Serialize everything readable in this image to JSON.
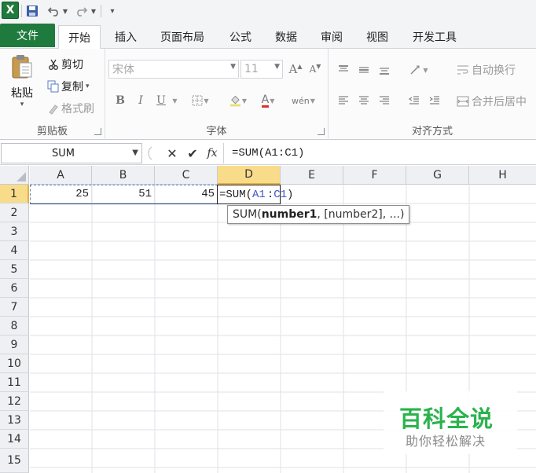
{
  "qat": {
    "logo": "X",
    "more": "▾"
  },
  "tabs": [
    "文件",
    "开始",
    "插入",
    "页面布局",
    "公式",
    "数据",
    "审阅",
    "视图",
    "开发工具"
  ],
  "clipboard": {
    "paste": "粘贴",
    "cut": "剪切",
    "copy": "复制",
    "painter": "格式刷",
    "label": "剪贴板"
  },
  "font": {
    "name": "宋体",
    "size": "11",
    "grow": "A",
    "shrink": "A",
    "bold": "B",
    "italic": "I",
    "underline": "U",
    "label": "字体"
  },
  "alignment": {
    "wrap": "自动换行",
    "merge": "合并后居中",
    "label": "对齐方式"
  },
  "formula_bar": {
    "name_box": "SUM",
    "fx": "fx",
    "formula": "=SUM(A1:C1)"
  },
  "grid": {
    "columns": [
      "A",
      "B",
      "C",
      "D",
      "E",
      "F",
      "G",
      "H"
    ],
    "rows": [
      "1",
      "2",
      "3",
      "4",
      "5",
      "6",
      "7",
      "8",
      "9",
      "10",
      "11",
      "12",
      "13",
      "14",
      "15"
    ],
    "cells": {
      "A1": "25",
      "B1": "51",
      "C1": "45"
    },
    "edit": {
      "prefix": "=SUM(",
      "ref1": "A1",
      "colon": ":",
      "ref2": "C1",
      "suffix": ")"
    },
    "tooltip": {
      "fn": "SUM(",
      "arg1": "number1",
      "rest": ", [number2], ...)"
    }
  },
  "watermark": {
    "title": "百科全说",
    "subtitle": "助你轻松解决"
  },
  "colors": {
    "file_tab": "#1e7a3d",
    "selected_header": "#f9dc8a",
    "reference": "#3a58c6",
    "watermark": "#2ab34d"
  }
}
